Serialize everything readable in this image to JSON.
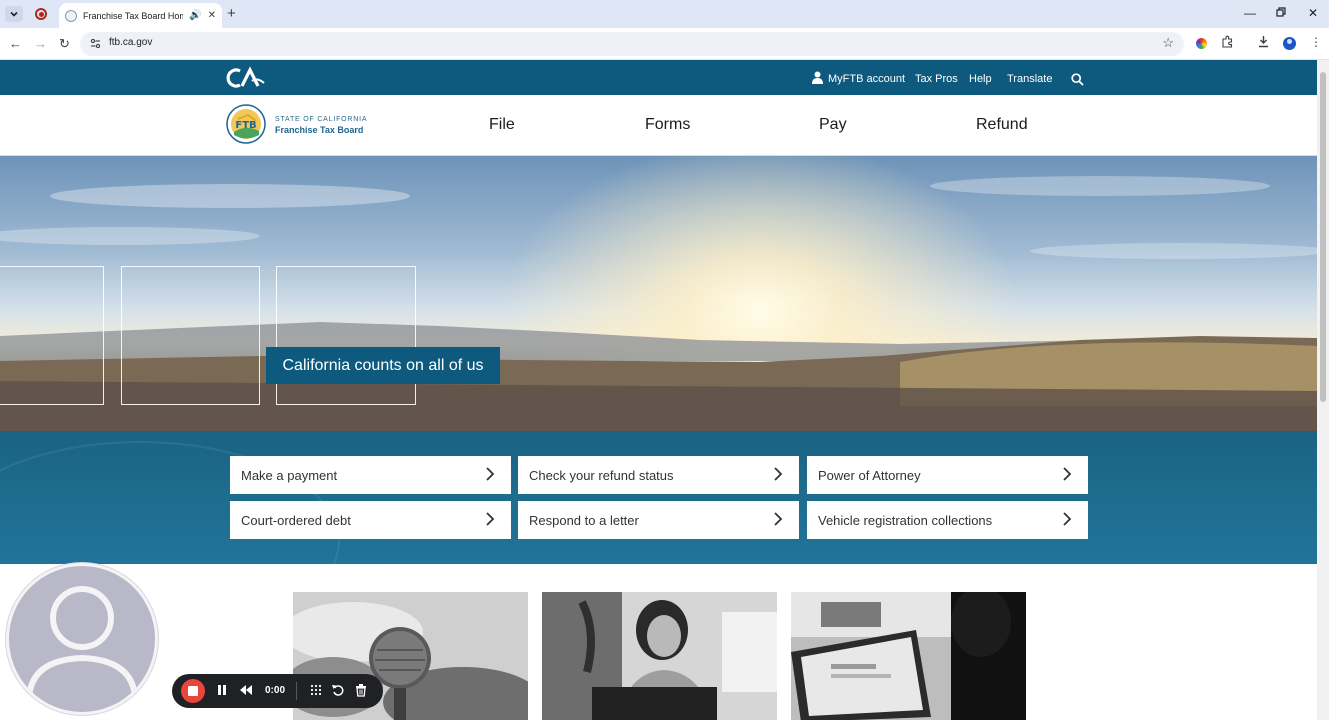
{
  "browser": {
    "tab_title": "Franchise Tax Board Homepage",
    "url": "ftb.ca.gov",
    "icons": [
      "tab-list-icon",
      "record-indicator-icon",
      "audio-icon",
      "close-icon",
      "new-tab-icon",
      "minimize-icon",
      "restore-icon",
      "close-window-icon",
      "back-icon",
      "forward-icon",
      "reload-icon",
      "site-info-icon",
      "bookmark-star-icon",
      "extension-icon",
      "puzzle-icon",
      "download-icon",
      "profile-icon",
      "menu-icon"
    ]
  },
  "utility_bar": {
    "links": [
      "MyFTB account",
      "Tax Pros",
      "Help",
      "Translate"
    ],
    "background_color": "#0e5a7e"
  },
  "header": {
    "agency_line1": "State of California",
    "agency_line2": "Franchise Tax Board",
    "nav": [
      "File",
      "Forms",
      "Pay",
      "Refund"
    ]
  },
  "hero": {
    "caption": "California counts on all of us"
  },
  "quick_links": [
    "Make a payment",
    "Check your refund status",
    "Power of Attorney",
    "Court-ordered debt",
    "Respond to a letter",
    "Vehicle registration collections"
  ],
  "recorder": {
    "time": "0:00",
    "accent_color": "#e8453c"
  }
}
